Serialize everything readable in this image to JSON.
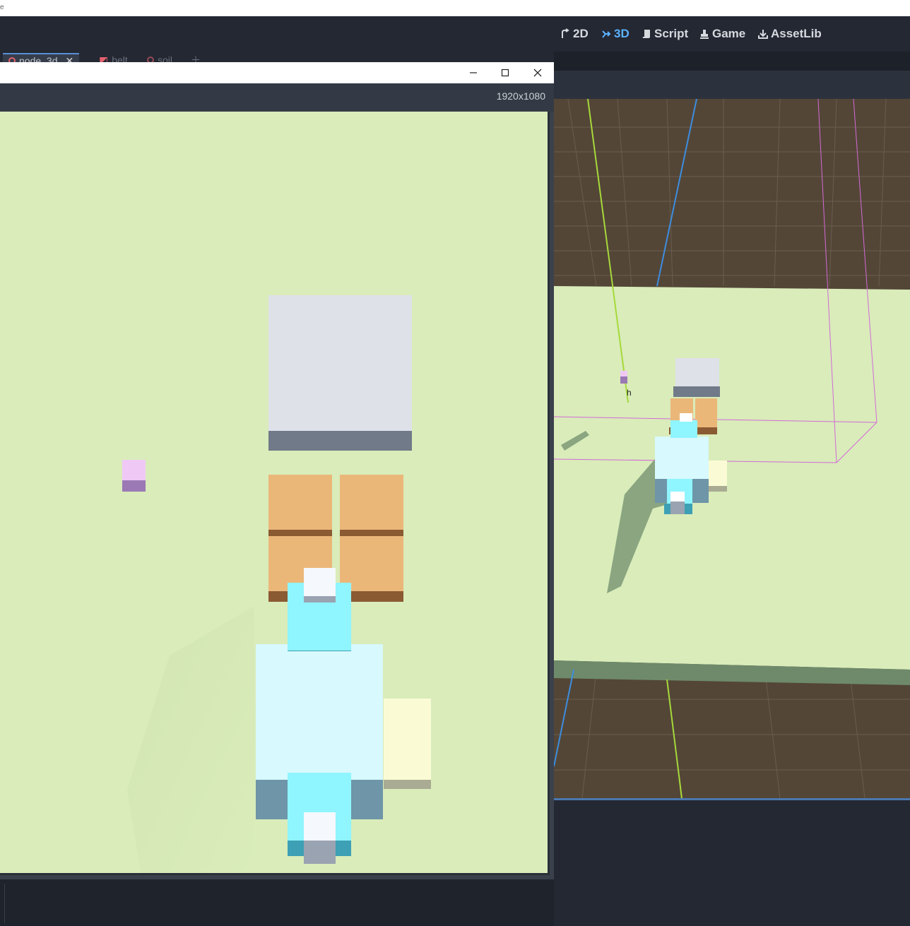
{
  "os_window": {
    "title": "e"
  },
  "workspaces": [
    {
      "label": "2D",
      "icon": "2d-icon",
      "active": false
    },
    {
      "label": "3D",
      "icon": "3d-icon",
      "active": true
    },
    {
      "label": "Script",
      "icon": "script-icon",
      "active": false
    },
    {
      "label": "Game",
      "icon": "game-icon",
      "active": false
    },
    {
      "label": "AssetLib",
      "icon": "assetlib-icon",
      "active": false
    }
  ],
  "scene_tabs": [
    {
      "label": "node_3d",
      "icon": "node3d-icon",
      "active": true
    },
    {
      "label": "belt",
      "icon": "belt-icon",
      "active": false
    },
    {
      "label": "soil",
      "icon": "node3d-icon",
      "active": false
    }
  ],
  "game_window": {
    "resolution": "1920x1080",
    "controls": {
      "minimize": "minimize-icon",
      "maximize": "maximize-icon",
      "close": "close-icon"
    }
  },
  "colors": {
    "ground": "#d9ecba",
    "grid_floor": "#534637",
    "active_accent": "#5cb2ff",
    "tab_icon": "#e5616d",
    "player_light": "#d8f9fe",
    "player_cyan": "#8ff5fe",
    "crate": "#ebb779",
    "crate_dark": "#8a5a33",
    "block_top": "#dfe1e8",
    "block_side": "#717a88",
    "item_pink": "#f0c8f6",
    "item_purple": "#9a79b4",
    "bounds_box": "#d46ad8"
  }
}
